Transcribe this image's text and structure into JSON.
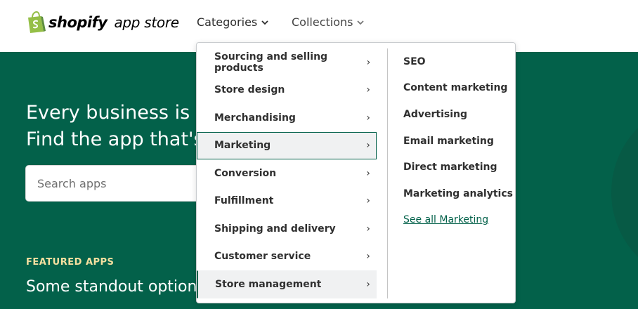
{
  "header": {
    "logo_brand": "shopify",
    "logo_store": "app store",
    "nav": {
      "categories_label": "Categories",
      "collections_label": "Collections"
    }
  },
  "hero": {
    "title_line1": "Every business is u",
    "title_line2": "Find the app that's",
    "search_placeholder": "Search apps",
    "featured_label": "FEATURED APPS",
    "featured_title": "Some standout option"
  },
  "dropdown": {
    "categories": [
      {
        "label": "Sourcing and selling products"
      },
      {
        "label": "Store design"
      },
      {
        "label": "Merchandising"
      },
      {
        "label": "Marketing"
      },
      {
        "label": "Conversion"
      },
      {
        "label": "Fulfillment"
      },
      {
        "label": "Shipping and delivery"
      },
      {
        "label": "Customer service"
      },
      {
        "label": "Store management"
      }
    ],
    "active_category": "Marketing",
    "subcategories": [
      {
        "label": "SEO"
      },
      {
        "label": "Content marketing"
      },
      {
        "label": "Advertising"
      },
      {
        "label": "Email marketing"
      },
      {
        "label": "Direct marketing"
      },
      {
        "label": "Marketing analytics"
      }
    ],
    "see_all_label": "See all Marketing"
  },
  "colors": {
    "brand_green": "#03614a",
    "logo_green": "#95bf47",
    "featured_yellow": "#f6e0a0"
  },
  "icons": {
    "logo": "shopify-bag-icon",
    "nav_chevron": "chevron-down-icon",
    "item_arrow": "chevron-right-icon"
  }
}
